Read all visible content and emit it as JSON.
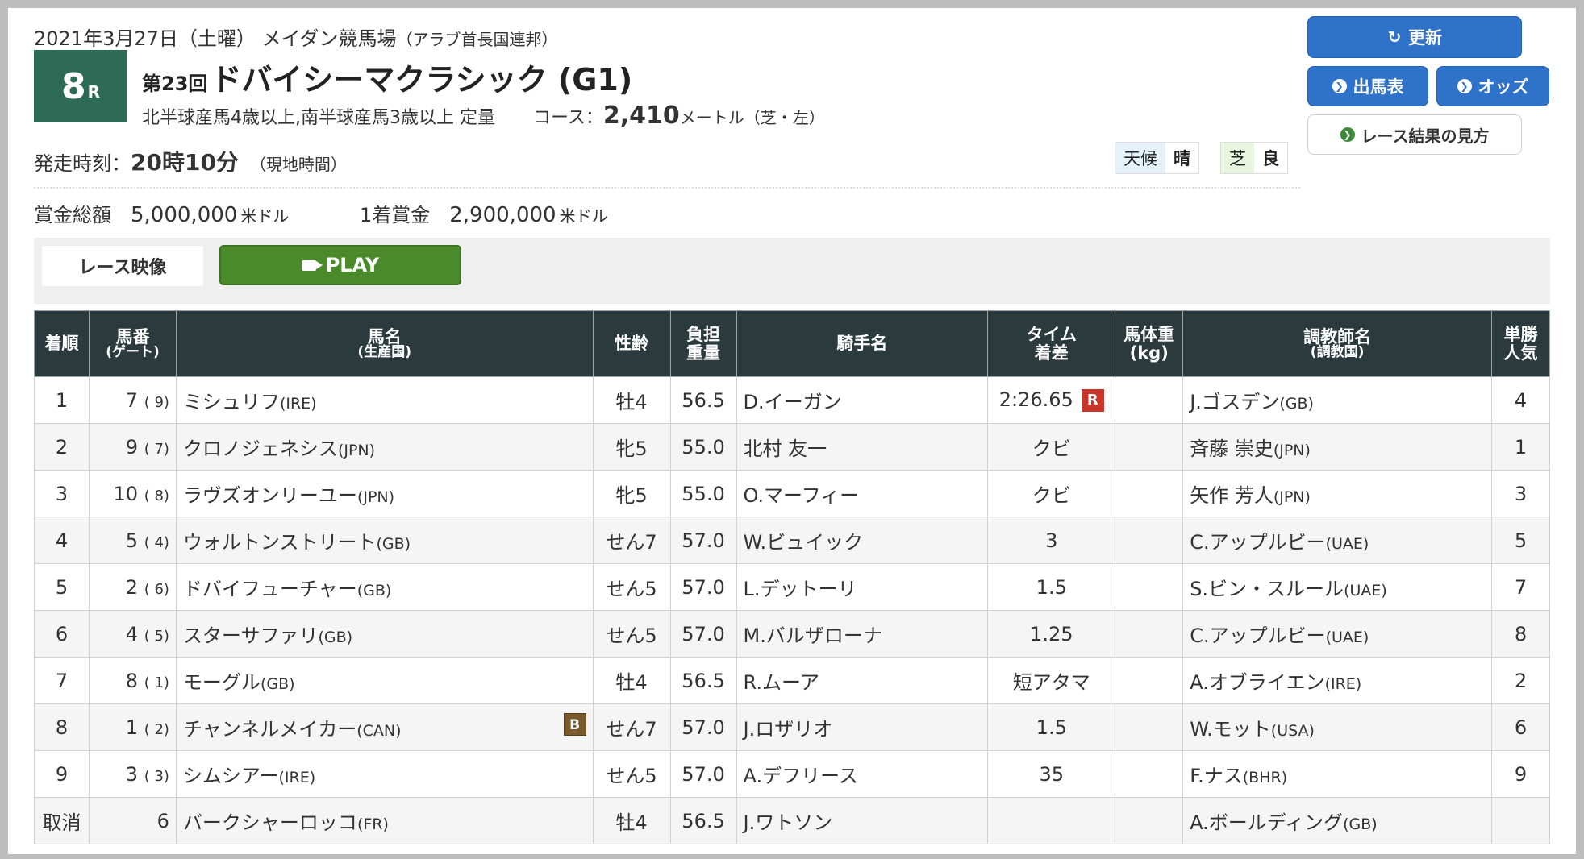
{
  "header": {
    "date_line": "2021年3月27日（土曜） メイダン競馬場",
    "country": "（アラブ首長国連邦）",
    "race_number": "8",
    "race_suffix": "R",
    "edition": "第23回",
    "race_name": "ドバイシーマクラシック (G1)",
    "conditions": "北半球産馬4歳以上,南半球産馬3歳以上 定量",
    "course_label": "コース：",
    "distance": "2,410",
    "distance_unit": "メートル（芝・左）",
    "start_label": "発走時刻：",
    "start_time": "20時10分",
    "start_note": "（現地時間）",
    "weather_label": "天候",
    "weather_value": "晴",
    "turf_label": "芝",
    "turf_value": "良",
    "prize_total_label": "賞金総額",
    "prize_total": "5,000,000",
    "prize_unit": "米ドル",
    "prize_first_label": "1着賞金",
    "prize_first": "2,900,000",
    "prize_first_unit": "米ドル"
  },
  "buttons": {
    "update": "更新",
    "card": "出馬表",
    "odds": "オッズ",
    "howto": "レース結果の見方"
  },
  "video": {
    "label": "レース映像",
    "play": "PLAY"
  },
  "table": {
    "headers": {
      "rank": "着順",
      "num": "馬番",
      "num_sub": "(ゲート)",
      "horse": "馬名",
      "horse_sub": "(生産国)",
      "sexage": "性齢",
      "weight1": "負担",
      "weight2": "重量",
      "jockey": "騎手名",
      "time1": "タイム",
      "time2": "着差",
      "bw1": "馬体重",
      "bw2": "(kg)",
      "trainer": "調教師名",
      "trainer_sub": "(調教国)",
      "pop1": "単勝",
      "pop2": "人気"
    },
    "rows": [
      {
        "rank": "1",
        "num": "7",
        "gate": "( 9)",
        "horse": "ミシュリフ",
        "horse_link": false,
        "origin": "(IRE)",
        "blinker": "",
        "sexage": "牡4",
        "weight": "56.5",
        "jockey": "D.イーガン",
        "jockey_link": false,
        "time": "2:26.65",
        "record": "R",
        "bodyweight": "",
        "trainer": "J.ゴスデン",
        "trainer_link": false,
        "trainer_origin": "(GB)",
        "pop": "4"
      },
      {
        "rank": "2",
        "num": "9",
        "gate": "( 7)",
        "horse": "クロノジェネシス",
        "horse_link": true,
        "origin": "(JPN)",
        "blinker": "",
        "sexage": "牝5",
        "weight": "55.0",
        "jockey": "北村 友一",
        "jockey_link": true,
        "time": "クビ",
        "record": "",
        "bodyweight": "",
        "trainer": "斉藤 崇史",
        "trainer_link": true,
        "trainer_origin": "(JPN)",
        "pop": "1"
      },
      {
        "rank": "3",
        "num": "10",
        "gate": "( 8)",
        "horse": "ラヴズオンリーユー",
        "horse_link": true,
        "origin": "(JPN)",
        "blinker": "",
        "sexage": "牝5",
        "weight": "55.0",
        "jockey": "O.マーフィー",
        "jockey_link": false,
        "time": "クビ",
        "record": "",
        "bodyweight": "",
        "trainer": "矢作 芳人",
        "trainer_link": true,
        "trainer_origin": "(JPN)",
        "pop": "3"
      },
      {
        "rank": "4",
        "num": "5",
        "gate": "( 4)",
        "horse": "ウォルトンストリート",
        "horse_link": false,
        "origin": "(GB)",
        "blinker": "",
        "sexage": "せん7",
        "weight": "57.0",
        "jockey": "W.ビュイック",
        "jockey_link": false,
        "time": "3",
        "record": "",
        "bodyweight": "",
        "trainer": "C.アップルビー",
        "trainer_link": false,
        "trainer_origin": "(UAE)",
        "pop": "5"
      },
      {
        "rank": "5",
        "num": "2",
        "gate": "( 6)",
        "horse": "ドバイフューチャー",
        "horse_link": false,
        "origin": "(GB)",
        "blinker": "",
        "sexage": "せん5",
        "weight": "57.0",
        "jockey": "L.デットーリ",
        "jockey_link": false,
        "time": "1.5",
        "record": "",
        "bodyweight": "",
        "trainer": "S.ビン・スルール",
        "trainer_link": false,
        "trainer_origin": "(UAE)",
        "pop": "7"
      },
      {
        "rank": "6",
        "num": "4",
        "gate": "( 5)",
        "horse": "スターサファリ",
        "horse_link": false,
        "origin": "(GB)",
        "blinker": "",
        "sexage": "せん5",
        "weight": "57.0",
        "jockey": "M.バルザローナ",
        "jockey_link": false,
        "time": "1.25",
        "record": "",
        "bodyweight": "",
        "trainer": "C.アップルビー",
        "trainer_link": false,
        "trainer_origin": "(UAE)",
        "pop": "8"
      },
      {
        "rank": "7",
        "num": "8",
        "gate": "( 1)",
        "horse": "モーグル",
        "horse_link": false,
        "origin": "(GB)",
        "blinker": "",
        "sexage": "牡4",
        "weight": "56.5",
        "jockey": "R.ムーア",
        "jockey_link": false,
        "time": "短アタマ",
        "record": "",
        "bodyweight": "",
        "trainer": "A.オブライエン",
        "trainer_link": false,
        "trainer_origin": "(IRE)",
        "pop": "2"
      },
      {
        "rank": "8",
        "num": "1",
        "gate": "( 2)",
        "horse": "チャンネルメイカー",
        "horse_link": false,
        "origin": "(CAN)",
        "blinker": "B",
        "sexage": "せん7",
        "weight": "57.0",
        "jockey": "J.ロザリオ",
        "jockey_link": false,
        "time": "1.5",
        "record": "",
        "bodyweight": "",
        "trainer": "W.モット",
        "trainer_link": false,
        "trainer_origin": "(USA)",
        "pop": "6"
      },
      {
        "rank": "9",
        "num": "3",
        "gate": "( 3)",
        "horse": "シムシアー",
        "horse_link": false,
        "origin": "(IRE)",
        "blinker": "",
        "sexage": "せん5",
        "weight": "57.0",
        "jockey": "A.デフリース",
        "jockey_link": false,
        "time": "35",
        "record": "",
        "bodyweight": "",
        "trainer": "F.ナス",
        "trainer_link": false,
        "trainer_origin": "(BHR)",
        "pop": "9"
      },
      {
        "rank": "取消",
        "num": "6",
        "gate": "",
        "horse": "バークシャーロッコ",
        "horse_link": false,
        "origin": "(FR)",
        "blinker": "",
        "sexage": "牡4",
        "weight": "56.5",
        "jockey": "J.ワトソン",
        "jockey_link": false,
        "time": "",
        "record": "",
        "bodyweight": "",
        "trainer": "A.ボールディング",
        "trainer_link": false,
        "trainer_origin": "(GB)",
        "pop": ""
      }
    ]
  }
}
